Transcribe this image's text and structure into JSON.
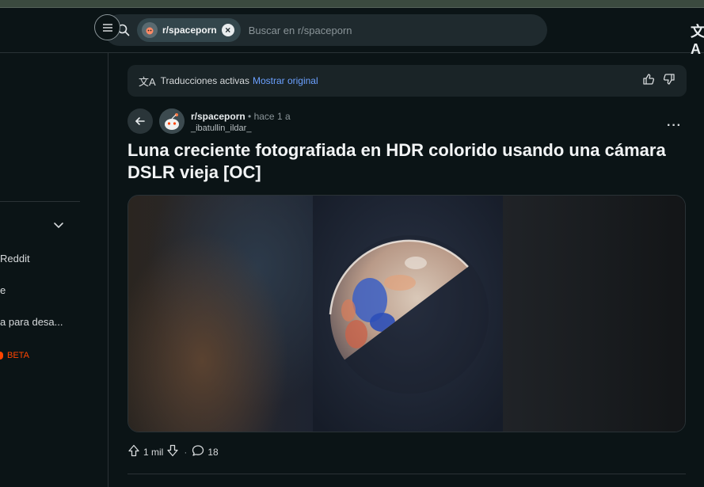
{
  "search": {
    "chip_label": "r/spaceporn",
    "placeholder": "Buscar en r/spaceporn"
  },
  "sidebar": {
    "items": [
      {
        "label": "Reddit"
      },
      {
        "label": "e"
      },
      {
        "label": "a para desa..."
      },
      {
        "label": "BETA"
      }
    ]
  },
  "banner": {
    "text": "Traducciones activas",
    "link": "Mostrar original"
  },
  "post": {
    "subreddit": "r/spaceporn",
    "time": "• hace 1 a",
    "author": "_ibatullin_ildar_",
    "title": "Luna creciente fotografiada en HDR colorido usando una cámara DSLR vieja [OC]",
    "votes": "1 mil",
    "comments": "18"
  },
  "colors": {
    "background": "#0b1416",
    "link": "#6ba0ff",
    "beta": "#ff4500"
  }
}
